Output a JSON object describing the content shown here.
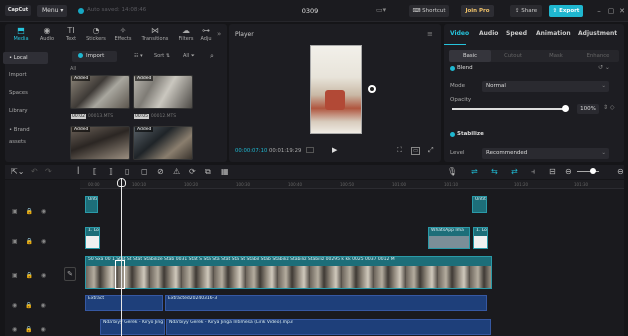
{
  "titlebar": {
    "logo": "CapCut",
    "menu": "Menu",
    "save_status": "Auto saved: 14:08:46",
    "project_title": "0309",
    "shortcut": "Shortcut",
    "join_pro": "Join Pro",
    "share": "Share",
    "export": "Export"
  },
  "media_tabs": [
    {
      "label": "Media",
      "icon": "media-icon"
    },
    {
      "label": "Audio",
      "icon": "audio-icon"
    },
    {
      "label": "Text",
      "icon": "text-icon"
    },
    {
      "label": "Stickers",
      "icon": "stickers-icon"
    },
    {
      "label": "Effects",
      "icon": "effects-icon"
    },
    {
      "label": "Transitions",
      "icon": "transitions-icon"
    },
    {
      "label": "Filters",
      "icon": "filters-icon"
    },
    {
      "label": "Adju",
      "icon": "adjust-icon"
    }
  ],
  "media_nav": [
    "• Local",
    "Import",
    "Spaces",
    "Library",
    "• Brand assets"
  ],
  "media_controls": {
    "import": "Import",
    "sort": "Sort",
    "all": "All",
    "all_label": "All"
  },
  "media_items": [
    {
      "added": "Added",
      "duration": "00:02",
      "name": "00013.MTS"
    },
    {
      "added": "Added",
      "duration": "00:05",
      "name": "00012.MTS"
    },
    {
      "added": "Added",
      "duration": "",
      "name": ""
    },
    {
      "added": "Added",
      "duration": "",
      "name": ""
    }
  ],
  "player": {
    "title": "Player",
    "time_current": "00:00:07:10",
    "time_total": "00:01:19:29"
  },
  "props": {
    "tabs": [
      "Video",
      "Audio",
      "Speed",
      "Animation",
      "Adjustment"
    ],
    "subtabs": [
      "Basic",
      "Cutout",
      "Mask",
      "Enhance"
    ],
    "blend_label": "Blend",
    "mode_label": "Mode",
    "mode_value": "Normal",
    "opacity_label": "Opacity",
    "opacity_value": "100%",
    "stabilize_label": "Stabilize",
    "level_label": "Level",
    "level_value": "Recommended"
  },
  "timeline": {
    "ruler": [
      "00:00",
      "100:10",
      "100:20",
      "100:30",
      "100:40",
      "100:50",
      "101:00",
      "101:10",
      "101:20",
      "101:30"
    ],
    "clips": {
      "top_clip_a": "Untit",
      "top_clip_b": "Untit",
      "mid_clip_a": "1. Lo",
      "mid_clip_b": "WhatsApp Ima",
      "mid_clip_c": "1. Lo",
      "main_strip": "50 Sxa 00 1 Stat St Stat Stabilize Stab 0031 Stat S Sta Sta Stat Sta St Stabil Stab Stabiliz Stabiliz Stabiliz 00295 k kk 0025 0037 0012 M",
      "audio_extract_a": "Extract",
      "audio_extract_b": "Extracted20240316-3",
      "music": "Nda'biyy Gerek - Kirya Jinga Intimesa (Lirik Video).mp3",
      "music_a": "Nda'biyy Gerek - Kiryo Jing"
    }
  },
  "colors": {
    "accent": "#1fb7d0",
    "teal_clip": "#1d6e79",
    "audio_clip": "#1e3f7a",
    "pro": "#f4c56a"
  }
}
